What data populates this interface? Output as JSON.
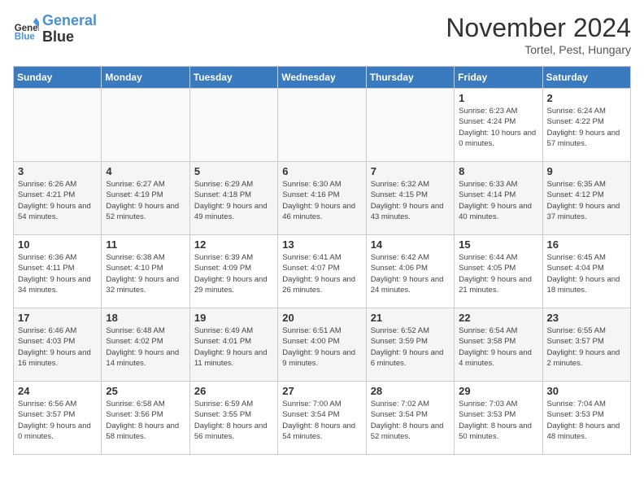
{
  "header": {
    "logo_line1": "General",
    "logo_line2": "Blue",
    "month": "November 2024",
    "location": "Tortel, Pest, Hungary"
  },
  "weekdays": [
    "Sunday",
    "Monday",
    "Tuesday",
    "Wednesday",
    "Thursday",
    "Friday",
    "Saturday"
  ],
  "weeks": [
    [
      {
        "day": "",
        "info": ""
      },
      {
        "day": "",
        "info": ""
      },
      {
        "day": "",
        "info": ""
      },
      {
        "day": "",
        "info": ""
      },
      {
        "day": "",
        "info": ""
      },
      {
        "day": "1",
        "info": "Sunrise: 6:23 AM\nSunset: 4:24 PM\nDaylight: 10 hours\nand 0 minutes."
      },
      {
        "day": "2",
        "info": "Sunrise: 6:24 AM\nSunset: 4:22 PM\nDaylight: 9 hours\nand 57 minutes."
      }
    ],
    [
      {
        "day": "3",
        "info": "Sunrise: 6:26 AM\nSunset: 4:21 PM\nDaylight: 9 hours\nand 54 minutes."
      },
      {
        "day": "4",
        "info": "Sunrise: 6:27 AM\nSunset: 4:19 PM\nDaylight: 9 hours\nand 52 minutes."
      },
      {
        "day": "5",
        "info": "Sunrise: 6:29 AM\nSunset: 4:18 PM\nDaylight: 9 hours\nand 49 minutes."
      },
      {
        "day": "6",
        "info": "Sunrise: 6:30 AM\nSunset: 4:16 PM\nDaylight: 9 hours\nand 46 minutes."
      },
      {
        "day": "7",
        "info": "Sunrise: 6:32 AM\nSunset: 4:15 PM\nDaylight: 9 hours\nand 43 minutes."
      },
      {
        "day": "8",
        "info": "Sunrise: 6:33 AM\nSunset: 4:14 PM\nDaylight: 9 hours\nand 40 minutes."
      },
      {
        "day": "9",
        "info": "Sunrise: 6:35 AM\nSunset: 4:12 PM\nDaylight: 9 hours\nand 37 minutes."
      }
    ],
    [
      {
        "day": "10",
        "info": "Sunrise: 6:36 AM\nSunset: 4:11 PM\nDaylight: 9 hours\nand 34 minutes."
      },
      {
        "day": "11",
        "info": "Sunrise: 6:38 AM\nSunset: 4:10 PM\nDaylight: 9 hours\nand 32 minutes."
      },
      {
        "day": "12",
        "info": "Sunrise: 6:39 AM\nSunset: 4:09 PM\nDaylight: 9 hours\nand 29 minutes."
      },
      {
        "day": "13",
        "info": "Sunrise: 6:41 AM\nSunset: 4:07 PM\nDaylight: 9 hours\nand 26 minutes."
      },
      {
        "day": "14",
        "info": "Sunrise: 6:42 AM\nSunset: 4:06 PM\nDaylight: 9 hours\nand 24 minutes."
      },
      {
        "day": "15",
        "info": "Sunrise: 6:44 AM\nSunset: 4:05 PM\nDaylight: 9 hours\nand 21 minutes."
      },
      {
        "day": "16",
        "info": "Sunrise: 6:45 AM\nSunset: 4:04 PM\nDaylight: 9 hours\nand 18 minutes."
      }
    ],
    [
      {
        "day": "17",
        "info": "Sunrise: 6:46 AM\nSunset: 4:03 PM\nDaylight: 9 hours\nand 16 minutes."
      },
      {
        "day": "18",
        "info": "Sunrise: 6:48 AM\nSunset: 4:02 PM\nDaylight: 9 hours\nand 14 minutes."
      },
      {
        "day": "19",
        "info": "Sunrise: 6:49 AM\nSunset: 4:01 PM\nDaylight: 9 hours\nand 11 minutes."
      },
      {
        "day": "20",
        "info": "Sunrise: 6:51 AM\nSunset: 4:00 PM\nDaylight: 9 hours\nand 9 minutes."
      },
      {
        "day": "21",
        "info": "Sunrise: 6:52 AM\nSunset: 3:59 PM\nDaylight: 9 hours\nand 6 minutes."
      },
      {
        "day": "22",
        "info": "Sunrise: 6:54 AM\nSunset: 3:58 PM\nDaylight: 9 hours\nand 4 minutes."
      },
      {
        "day": "23",
        "info": "Sunrise: 6:55 AM\nSunset: 3:57 PM\nDaylight: 9 hours\nand 2 minutes."
      }
    ],
    [
      {
        "day": "24",
        "info": "Sunrise: 6:56 AM\nSunset: 3:57 PM\nDaylight: 9 hours\nand 0 minutes."
      },
      {
        "day": "25",
        "info": "Sunrise: 6:58 AM\nSunset: 3:56 PM\nDaylight: 8 hours\nand 58 minutes."
      },
      {
        "day": "26",
        "info": "Sunrise: 6:59 AM\nSunset: 3:55 PM\nDaylight: 8 hours\nand 56 minutes."
      },
      {
        "day": "27",
        "info": "Sunrise: 7:00 AM\nSunset: 3:54 PM\nDaylight: 8 hours\nand 54 minutes."
      },
      {
        "day": "28",
        "info": "Sunrise: 7:02 AM\nSunset: 3:54 PM\nDaylight: 8 hours\nand 52 minutes."
      },
      {
        "day": "29",
        "info": "Sunrise: 7:03 AM\nSunset: 3:53 PM\nDaylight: 8 hours\nand 50 minutes."
      },
      {
        "day": "30",
        "info": "Sunrise: 7:04 AM\nSunset: 3:53 PM\nDaylight: 8 hours\nand 48 minutes."
      }
    ]
  ]
}
